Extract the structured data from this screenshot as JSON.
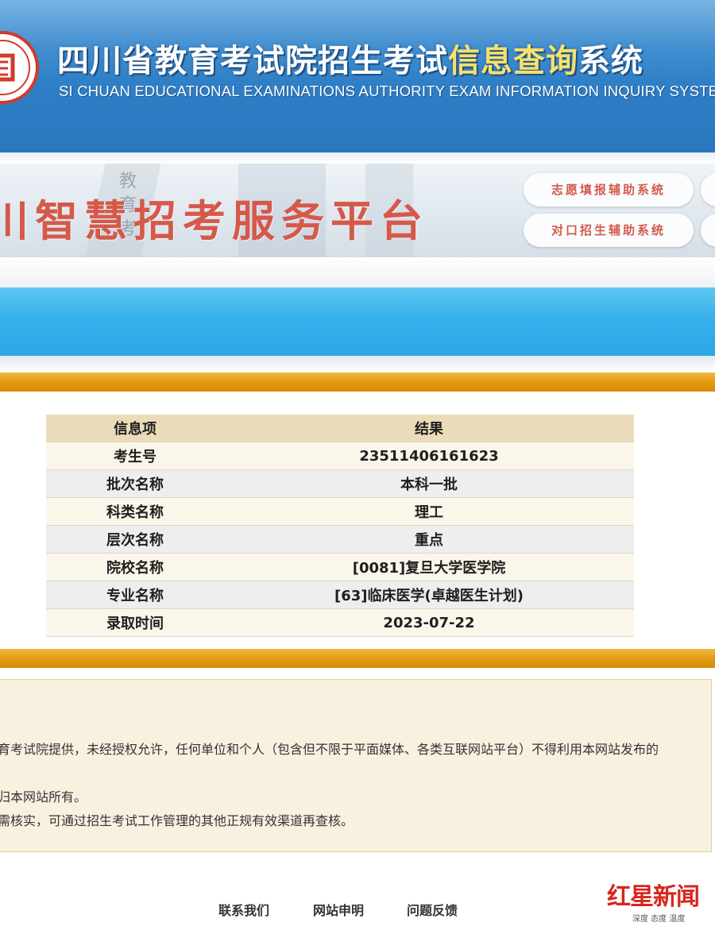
{
  "header": {
    "title_main": "四川省教育考试院招生考试",
    "title_accent": "信息查询",
    "title_tail": "系统",
    "subtitle": "SI CHUAN EDUCATIONAL EXAMINATIONS AUTHORITY EXAM INFORMATION INQUIRY SYSTEM"
  },
  "banner": {
    "title": "川智慧招考服务平台",
    "background_text": "教育考",
    "buttons": [
      {
        "label": "志愿填报辅助系统"
      },
      {
        "label": "对口招生辅助系统"
      }
    ]
  },
  "result_table": {
    "headers": [
      "信息项",
      "结果"
    ],
    "rows": [
      {
        "item": "考生号",
        "value": "23511406161623"
      },
      {
        "item": "批次名称",
        "value": "本科一批"
      },
      {
        "item": "科类名称",
        "value": "理工"
      },
      {
        "item": "层次名称",
        "value": "重点"
      },
      {
        "item": "院校名称",
        "value": "[0081]复旦大学医学院"
      },
      {
        "item": "专业名称",
        "value": "[63]临床医学(卓越医生计划)"
      },
      {
        "item": "录取时间",
        "value": "2023-07-22"
      }
    ]
  },
  "notice": {
    "line1": "育考试院提供，未经授权允许，任何单位和个人（包含但不限于平面媒体、各类互联网站平台）不得利用本网站发布的",
    "line2": "归本网站所有。",
    "line3": "需核实，可通过招生考试工作管理的其他正规有效渠道再查核。"
  },
  "footer": {
    "links": [
      "联系我们",
      "网站申明",
      "问题反馈"
    ]
  },
  "watermark": {
    "main": "红星新闻",
    "sub": "深度 态度 温度"
  },
  "colors": {
    "header_blue": "#2f7fc6",
    "title_accent": "#f7e16b",
    "banner_red": "#d5594a",
    "orange_bar": "#e39a14",
    "table_header": "#eadcb8",
    "watermark_red": "#d7261e"
  }
}
